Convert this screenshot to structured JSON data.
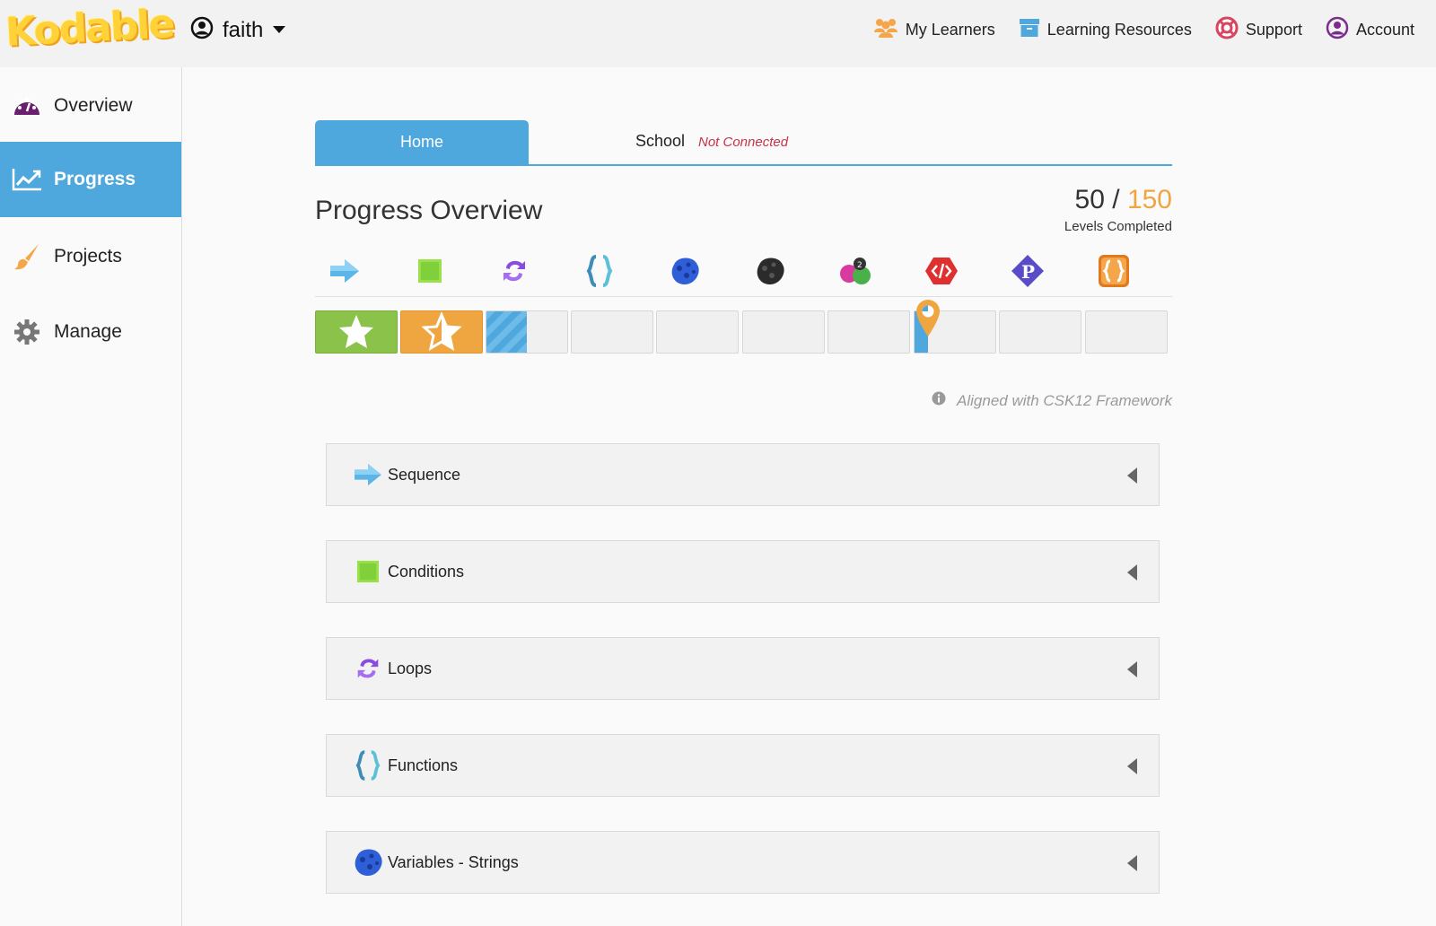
{
  "app": {
    "logo_text": "Kodable"
  },
  "user_menu": {
    "name": "faith"
  },
  "nav": {
    "my_learners": "My Learners",
    "learning_resources": "Learning Resources",
    "support": "Support",
    "account": "Account"
  },
  "sidebar": {
    "items": [
      {
        "label": "Overview",
        "icon": "dashboard-gauge-icon"
      },
      {
        "label": "Progress",
        "icon": "chart-line-icon",
        "active": true
      },
      {
        "label": "Projects",
        "icon": "paintbrush-icon"
      },
      {
        "label": "Manage",
        "icon": "gear-icon"
      }
    ]
  },
  "tabs": {
    "home": "Home",
    "school": "School",
    "school_status": "Not Connected"
  },
  "overview": {
    "title": "Progress Overview",
    "completed": "50",
    "separator": "/",
    "total": "150",
    "completed_label": "Levels Completed",
    "aligned": "Aligned with CSK12 Framework"
  },
  "concept_icons": [
    "sequence-arrow-icon",
    "conditions-square-icon",
    "loops-cycle-icon",
    "functions-braces-icon",
    "variables-strings-blob-icon",
    "variables-integers-blob-icon",
    "variables-mixed-blob-icon",
    "code-hexagon-icon",
    "properties-diamond-icon",
    "object-braces-icon"
  ],
  "progress": {
    "cells": [
      "complete",
      "partial-star",
      "in-progress",
      "empty",
      "empty",
      "empty",
      "empty",
      "marker",
      "empty",
      "empty"
    ],
    "colors": {
      "complete": "#8bc34a",
      "partial": "#f0a640",
      "in_progress": "#4ea8de",
      "marker": "#f0a640"
    }
  },
  "concepts": [
    {
      "label": "Sequence",
      "icon": "sequence-arrow-icon"
    },
    {
      "label": "Conditions",
      "icon": "conditions-square-icon"
    },
    {
      "label": "Loops",
      "icon": "loops-cycle-icon"
    },
    {
      "label": "Functions",
      "icon": "functions-braces-icon"
    },
    {
      "label": "Variables - Strings",
      "icon": "variables-strings-blob-icon"
    }
  ],
  "colors": {
    "accent": "#4ea8de",
    "alert": "#c8324a",
    "highlight": "#f0a640"
  }
}
